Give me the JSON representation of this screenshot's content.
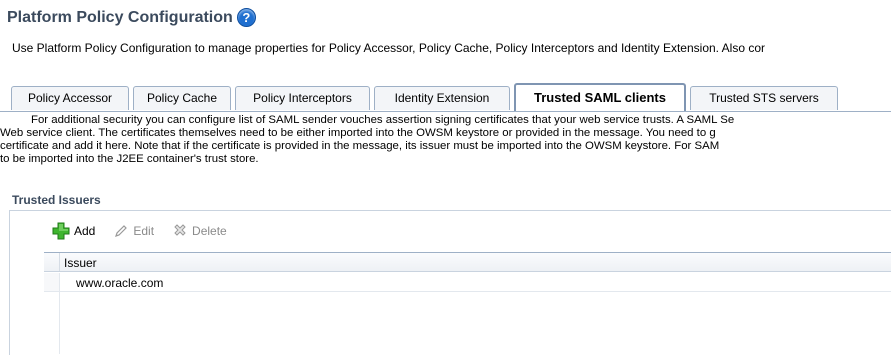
{
  "header": {
    "title": "Platform Policy Configuration",
    "help_glyph": "?",
    "description": "Use Platform Policy Configuration to manage properties for Policy Accessor, Policy Cache, Policy Interceptors and Identity Extension. Also cor"
  },
  "tabs": [
    {
      "label": "Policy Accessor"
    },
    {
      "label": "Policy Cache"
    },
    {
      "label": "Policy Interceptors"
    },
    {
      "label": "Identity Extension"
    },
    {
      "label": "Trusted SAML clients",
      "active": true
    },
    {
      "label": "Trusted STS servers"
    }
  ],
  "intro": {
    "line1": "For additional security you can configure list of SAML sender vouches assertion signing certificates that your web service trusts. A SAML Se",
    "line2": "Web service client. The certificates themselves need to be either imported into the OWSM keystore or provided in the message. You need to g",
    "line3": "certificate and add it here. Note that if the certificate is provided in the message, its issuer must be imported into the OWSM keystore. For SAM",
    "line4": "to be imported into the J2EE container's trust store."
  },
  "section": {
    "title": "Trusted Issuers"
  },
  "toolbar": {
    "add_label": "Add",
    "edit_label": "Edit",
    "delete_label": "Delete"
  },
  "table": {
    "columns": [
      "Issuer"
    ],
    "rows": [
      {
        "issuer": "www.oracle.com"
      }
    ]
  },
  "colors": {
    "title": "#3b4a5d",
    "help_icon": "#1f6fd0",
    "add_icon": "#2e9e23",
    "tab_border": "#9eb0c6"
  },
  "icons": [
    "help-icon",
    "add-icon",
    "edit-pencil-icon",
    "delete-icon"
  ]
}
